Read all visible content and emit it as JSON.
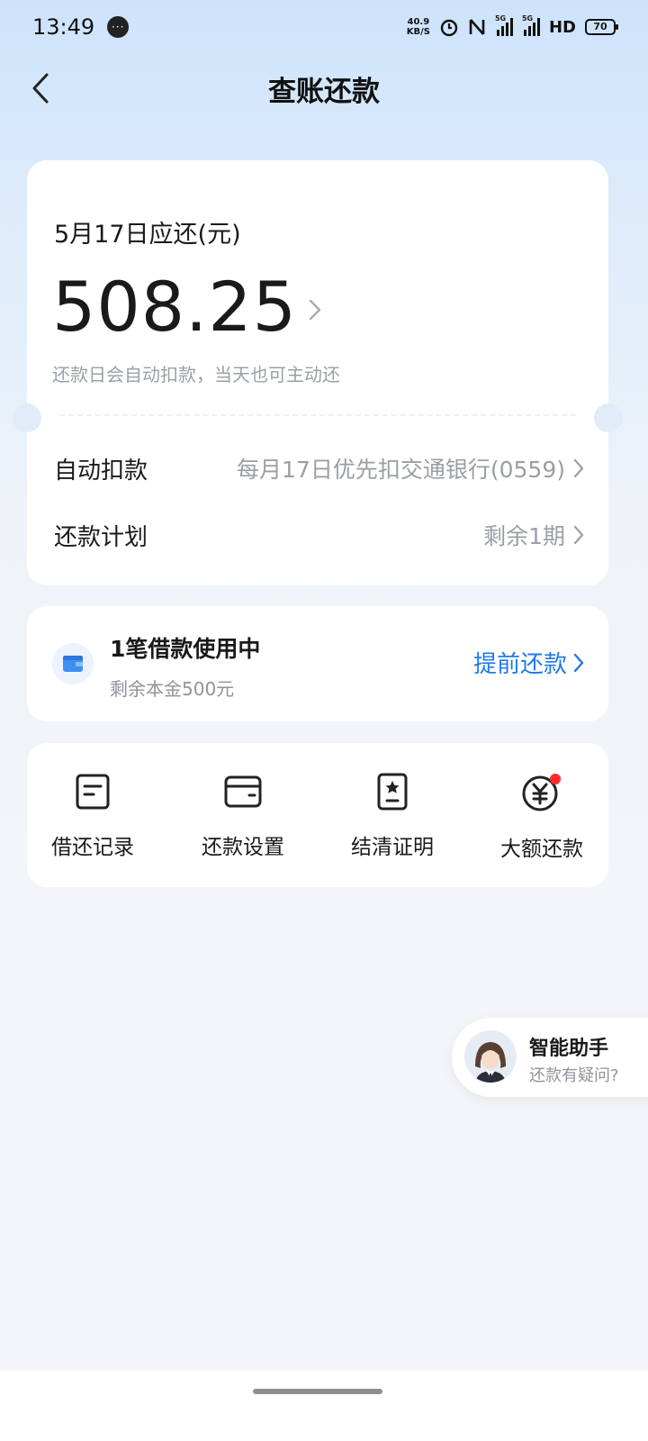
{
  "status_bar": {
    "time": "13:49",
    "chat_icon": "···",
    "net_speed_value": "40.9",
    "net_speed_unit": "KB/S",
    "signal_tag_1": "5G",
    "signal_tag_2": "5G",
    "hd": "HD",
    "battery": "70"
  },
  "nav": {
    "title": "查账还款"
  },
  "bill": {
    "due_label": "5月17日应还(元)",
    "amount": "508.25",
    "hint": "还款日会自动扣款，当天也可主动还",
    "auto_debit_label": "自动扣款",
    "auto_debit_value": "每月17日优先扣交通银行(0559)",
    "plan_label": "还款计划",
    "plan_value": "剩余1期"
  },
  "loan": {
    "title": "1笔借款使用中",
    "subtitle": "剩余本金500元",
    "prepay_label": "提前还款"
  },
  "actions": [
    {
      "label": "借还记录",
      "icon": "record-icon"
    },
    {
      "label": "还款设置",
      "icon": "wallet-settings-icon"
    },
    {
      "label": "结清证明",
      "icon": "certificate-icon"
    },
    {
      "label": "大额还款",
      "icon": "yuan-icon"
    }
  ],
  "assistant": {
    "title": "智能助手",
    "subtitle": "还款有疑问?"
  },
  "colors": {
    "accent": "#1f7ae8",
    "badge": "#ff2a2a",
    "background_top": "#cde3fb"
  }
}
